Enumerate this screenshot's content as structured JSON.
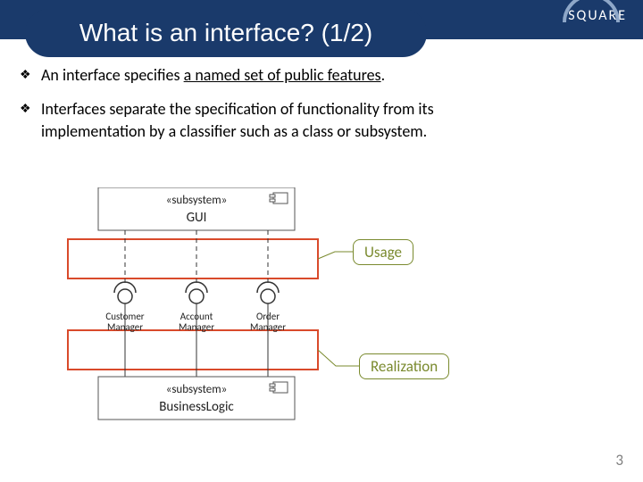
{
  "header": {
    "title": "What is an interface? (1/2)"
  },
  "brand": {
    "label": "SQUARE"
  },
  "bullets": [
    {
      "prefix": "An interface specifies ",
      "emphasis": "a named set of public features",
      "suffix": "."
    },
    {
      "text": "Interfaces separate the specification of functionality from its implementation by a classifier such as a class or subsystem."
    }
  ],
  "diagram": {
    "subsystem_top": {
      "stereotype": "«subsystem»",
      "name": "GUI"
    },
    "subsystem_bottom": {
      "stereotype": "«subsystem»",
      "name": "BusinessLogic"
    },
    "interfaces": [
      {
        "name": "Customer Manager"
      },
      {
        "name": "Account Manager"
      },
      {
        "name": "Order Manager"
      }
    ],
    "callouts": {
      "usage": "Usage",
      "realization": "Realization"
    }
  },
  "page_number": "3"
}
